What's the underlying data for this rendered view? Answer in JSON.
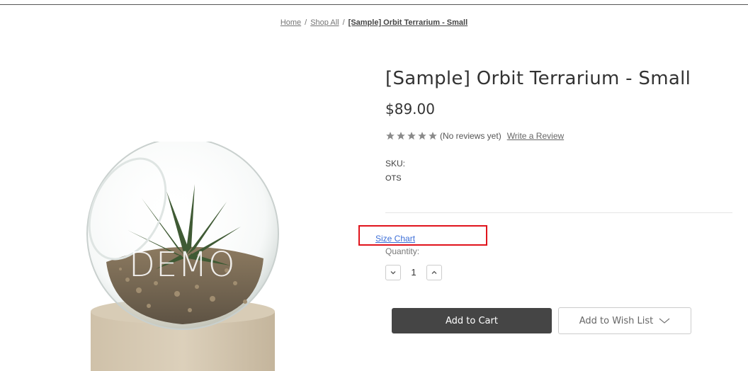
{
  "breadcrumb": {
    "home": "Home",
    "shop_all": "Shop All",
    "current": "[Sample] Orbit Terrarium - Small",
    "separator": "/"
  },
  "product": {
    "image_watermark": "DEMO",
    "title": "[Sample] Orbit Terrarium - Small",
    "price": "$89.00",
    "rating": {
      "stars_filled": 0,
      "stars_total": 5,
      "reviews_text": "(No reviews yet)",
      "write_review": "Write a Review",
      "star_color": "#8a8a8a"
    },
    "sku_label": "SKU:",
    "sku_value": "OTS"
  },
  "options": {
    "size_chart": "Size Chart",
    "quantity_label": "Quantity:",
    "quantity_value": "1"
  },
  "actions": {
    "add_to_cart": "Add to Cart",
    "add_to_wishlist": "Add to Wish List"
  },
  "colors": {
    "highlight_box": "#e0141c",
    "link_blue": "#3d6fd8",
    "cart_button": "#454545"
  },
  "icons": {
    "star": "star-icon",
    "quantity_decrease": "chevron-down-icon",
    "quantity_increase": "chevron-up-icon",
    "wishlist_dropdown": "chevron-down-icon"
  }
}
